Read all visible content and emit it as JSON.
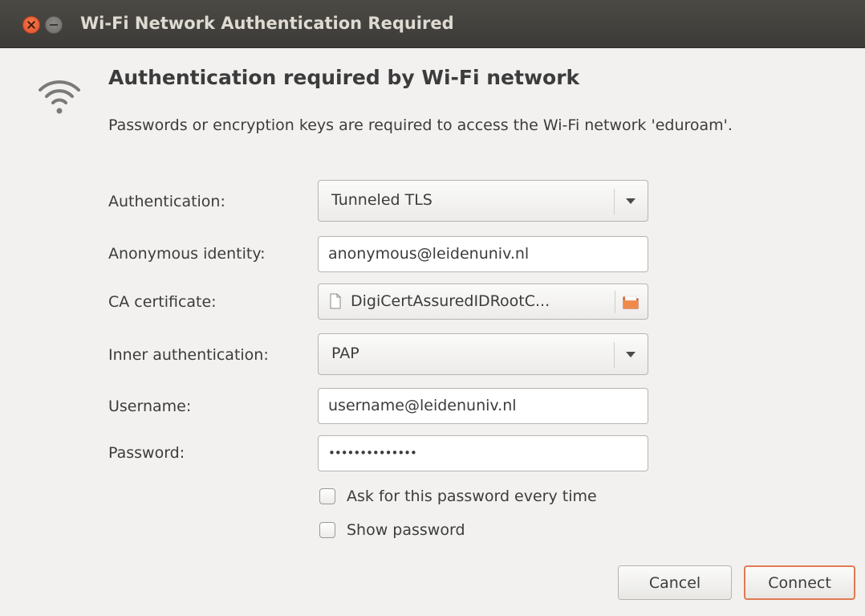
{
  "window": {
    "title": "Wi-Fi Network Authentication Required"
  },
  "icons": {
    "wifi": "wifi-icon",
    "document": "document-icon",
    "folder": "folder-icon",
    "dropdown": "chevron-down-icon"
  },
  "dialog": {
    "heading": "Authentication required by Wi-Fi network",
    "description": "Passwords or encryption keys are required to access the Wi-Fi network 'eduroam'."
  },
  "form": {
    "authentication": {
      "label": "Authentication:",
      "value": "Tunneled TLS"
    },
    "anonymous_identity": {
      "label": "Anonymous identity:",
      "value": "anonymous@leidenuniv.nl"
    },
    "ca_certificate": {
      "label": "CA certificate:",
      "value": "DigiCertAssuredIDRootC..."
    },
    "inner_authentication": {
      "label": "Inner authentication:",
      "value": "PAP"
    },
    "username": {
      "label": "Username:",
      "value": "username@leidenuniv.nl"
    },
    "password": {
      "label": "Password:",
      "value": "••••••••••••••"
    },
    "ask_password": {
      "label": "Ask for this password every time",
      "checked": false
    },
    "show_password": {
      "label": "Show password",
      "checked": false
    }
  },
  "buttons": {
    "cancel": "Cancel",
    "connect": "Connect"
  },
  "colors": {
    "titlebar": "#3c3b37",
    "close_button": "#e95420",
    "default_button_border": "#e07a52",
    "background": "#f2f1f0"
  }
}
